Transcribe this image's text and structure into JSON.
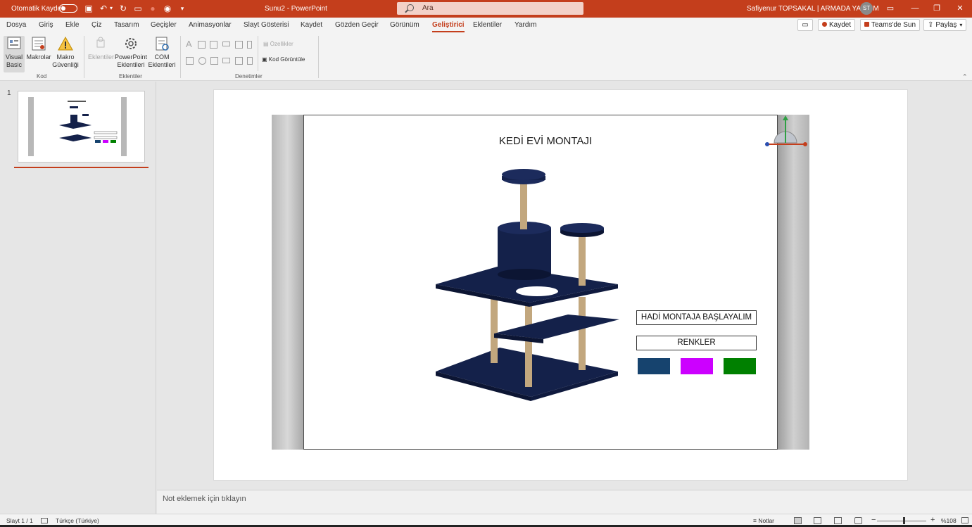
{
  "titlebar": {
    "autosave_label": "Otomatik Kaydet",
    "document_title": "Sunu2  -  PowerPoint",
    "search_placeholder": "Ara",
    "user_name": "Safiyenur TOPSAKAL | ARMADA YAZILIM",
    "user_initials": "ST"
  },
  "tabs": [
    "Dosya",
    "Giriş",
    "Ekle",
    "Çiz",
    "Tasarım",
    "Geçişler",
    "Animasyonlar",
    "Slayt Gösterisi",
    "Kaydet",
    "Gözden Geçir",
    "Görünüm",
    "Geliştirici",
    "Eklentiler",
    "Yardım"
  ],
  "active_tab": "Geliştirici",
  "ribbon_right": {
    "comment_icon": "comment-icon",
    "record_label": "Kaydet",
    "teams_label": "Teams'de Sun",
    "share_label": "Paylaş"
  },
  "ribbon": {
    "kod": {
      "visual_basic": "Visual Basic",
      "macros": "Makrolar",
      "macro_security": "Makro Güvenliği",
      "group_label": "Kod"
    },
    "eklentiler": {
      "addins": "Eklentiler",
      "ppt_addins": "PowerPoint Eklentileri",
      "com_addins": "COM Eklentileri",
      "group_label": "Eklentiler"
    },
    "denetimler": {
      "properties": "Özellikler",
      "view_code": "Kod Görüntüle",
      "group_label": "Denetimler"
    }
  },
  "thumbnails": {
    "slide_number": "1"
  },
  "slide": {
    "title": "KEDİ EVİ MONTAJI",
    "start_button": "HADİ MONTAJA BAŞLAYALIM",
    "colors_label": "RENKLER",
    "swatches": [
      "#16436e",
      "#cc00ff",
      "#008000"
    ],
    "model_color": "#14214a",
    "post_color": "#c2a77e"
  },
  "notes": {
    "placeholder": "Not eklemek için tıklayın"
  },
  "status": {
    "slide_info": "Slayt 1 / 1",
    "language": "Türkçe (Türkiye)",
    "notes_label": "Notlar",
    "zoom": "%108"
  },
  "colors": {
    "accent": "#c43e1c"
  }
}
